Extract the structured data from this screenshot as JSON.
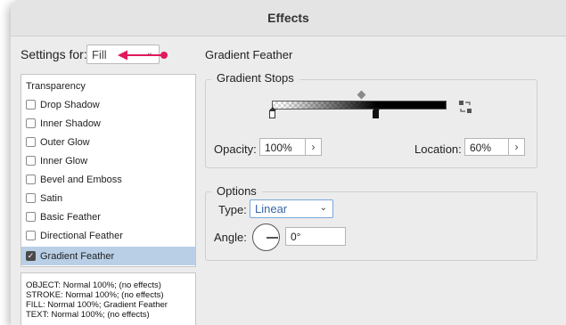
{
  "window": {
    "title": "Effects"
  },
  "settings": {
    "label": "Settings for:",
    "value": "Fill"
  },
  "effects_list": {
    "header": "Transparency",
    "items": [
      {
        "label": "Drop Shadow",
        "checked": false
      },
      {
        "label": "Inner Shadow",
        "checked": false
      },
      {
        "label": "Outer Glow",
        "checked": false
      },
      {
        "label": "Inner Glow",
        "checked": false
      },
      {
        "label": "Bevel and Emboss",
        "checked": false
      },
      {
        "label": "Satin",
        "checked": false
      },
      {
        "label": "Basic Feather",
        "checked": false
      },
      {
        "label": "Directional Feather",
        "checked": false
      },
      {
        "label": "Gradient Feather",
        "checked": true
      }
    ]
  },
  "summary": [
    "OBJECT: Normal 100%; (no effects)",
    "STROKE: Normal 100%; (no effects)",
    "FILL: Normal 100%; Gradient Feather",
    "TEXT: Normal 100%; (no effects)"
  ],
  "panel": {
    "title": "Gradient Feather",
    "gradient_stops": {
      "label": "Gradient Stops",
      "opacity_label": "Opacity:",
      "opacity_value": "100%",
      "location_label": "Location:",
      "location_value": "60%"
    },
    "options": {
      "label": "Options",
      "type_label": "Type:",
      "type_value": "Linear",
      "angle_label": "Angle:",
      "angle_value": "0°"
    }
  },
  "colors": {
    "annotation_arrow": "#e0185e",
    "selected_row": "#b9cfe6"
  }
}
